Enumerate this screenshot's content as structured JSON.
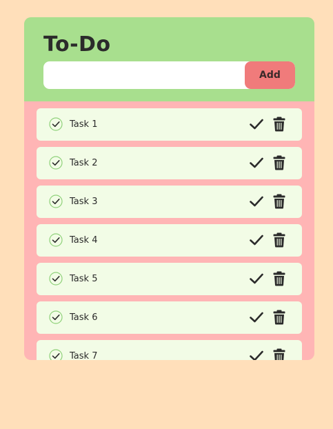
{
  "header": {
    "title": "To-Do"
  },
  "input": {
    "value": "",
    "placeholder": "",
    "add_label": "Add"
  },
  "tasks": [
    {
      "label": "Task 1"
    },
    {
      "label": "Task 2"
    },
    {
      "label": "Task 3"
    },
    {
      "label": "Task 4"
    },
    {
      "label": "Task 5"
    },
    {
      "label": "Task 6"
    },
    {
      "label": "Task 7"
    }
  ],
  "icons": {
    "status": "check-circle-icon",
    "complete": "check-icon",
    "delete": "trash-icon"
  },
  "colors": {
    "page_background": "#FFDFBA",
    "header_background": "#A8DF8E",
    "list_background": "#FFB5B5",
    "task_background": "#F2FCE6",
    "add_button": "#F07B7B",
    "text": "#2b2b2b",
    "check_circle": "#6CBF4A"
  }
}
